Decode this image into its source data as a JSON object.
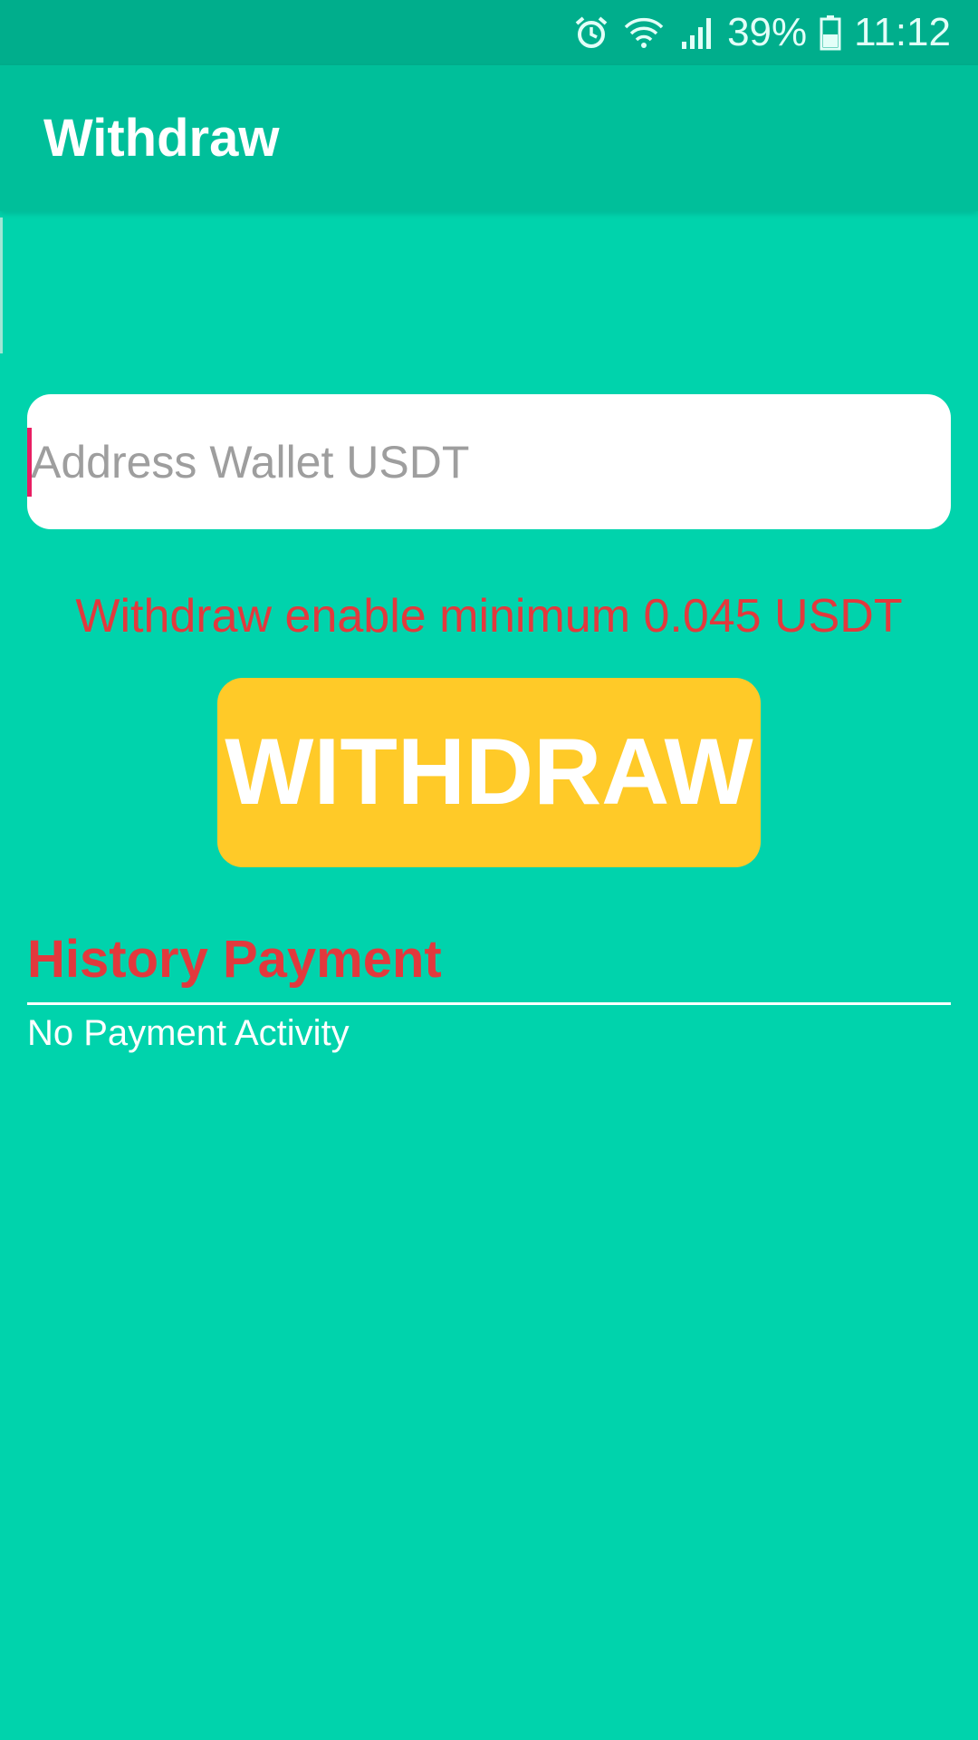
{
  "status_bar": {
    "battery": "39%",
    "time": "11:12",
    "icons": [
      "alarm-icon",
      "wifi-icon",
      "signal-icon",
      "battery-icon"
    ]
  },
  "app_bar": {
    "title": "Withdraw"
  },
  "form": {
    "address_placeholder": "Address Wallet USDT",
    "address_value": "",
    "min_notice": "Withdraw enable minimum 0.045 USDT",
    "withdraw_label": "WITHDRAW"
  },
  "history": {
    "title": "History Payment",
    "empty_text": "No Payment Activity"
  },
  "colors": {
    "background": "#00D3AC",
    "app_bar": "#00BF9A",
    "status_bar": "#00AE8C",
    "accent_red": "#E2393D",
    "button": "#FFCA28",
    "caret": "#E91E63"
  }
}
